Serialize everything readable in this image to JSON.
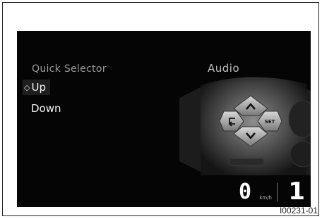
{
  "menu": {
    "title": "Quick Selector",
    "items": [
      {
        "label": "Up",
        "selected": true
      },
      {
        "label": "Down",
        "selected": false
      }
    ],
    "selected_icon": "pointer-icon"
  },
  "section": {
    "label": "Audio"
  },
  "controller": {
    "up_icon": "chevron-up-icon",
    "down_icon": "chevron-down-icon",
    "back_icon": "back-arrow-icon",
    "set_label": "SET"
  },
  "cluster": {
    "speed": "0",
    "unit": "km/h",
    "gear": "1"
  },
  "figure_id": "I00231-01",
  "colors": {
    "screen_bg": "#050505",
    "text": "#f2f2f2",
    "muted": "#9a9a9a"
  }
}
